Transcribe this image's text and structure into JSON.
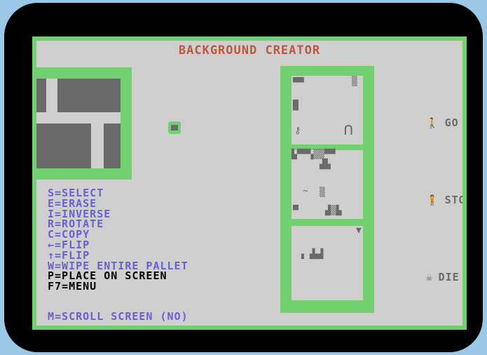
{
  "title": "BACKGROUND CREATOR",
  "menu": [
    "S=SELECT",
    "E=ERASE",
    "I=INVERSE",
    "R=ROTATE",
    "C=COPY",
    "←=FLIP",
    "↑=FLIP",
    "W=WIPE ENTIRE PALLET",
    "P=PLACE ON SCREEN",
    "F7=MENU"
  ],
  "scroll_option": "M=SCROLL SCREEN (NO)",
  "status": {
    "go": "GO",
    "stop": "STOP",
    "die": "DIE"
  },
  "icons": {
    "go": "walker-icon",
    "stop": "stand-icon",
    "die": "skull-icon"
  },
  "colors": {
    "border": "#72d06e",
    "screen": "#cfcfcf",
    "title": "#c0563d",
    "menu": "#6a5ed6",
    "sprite": "#6a6a6a"
  }
}
